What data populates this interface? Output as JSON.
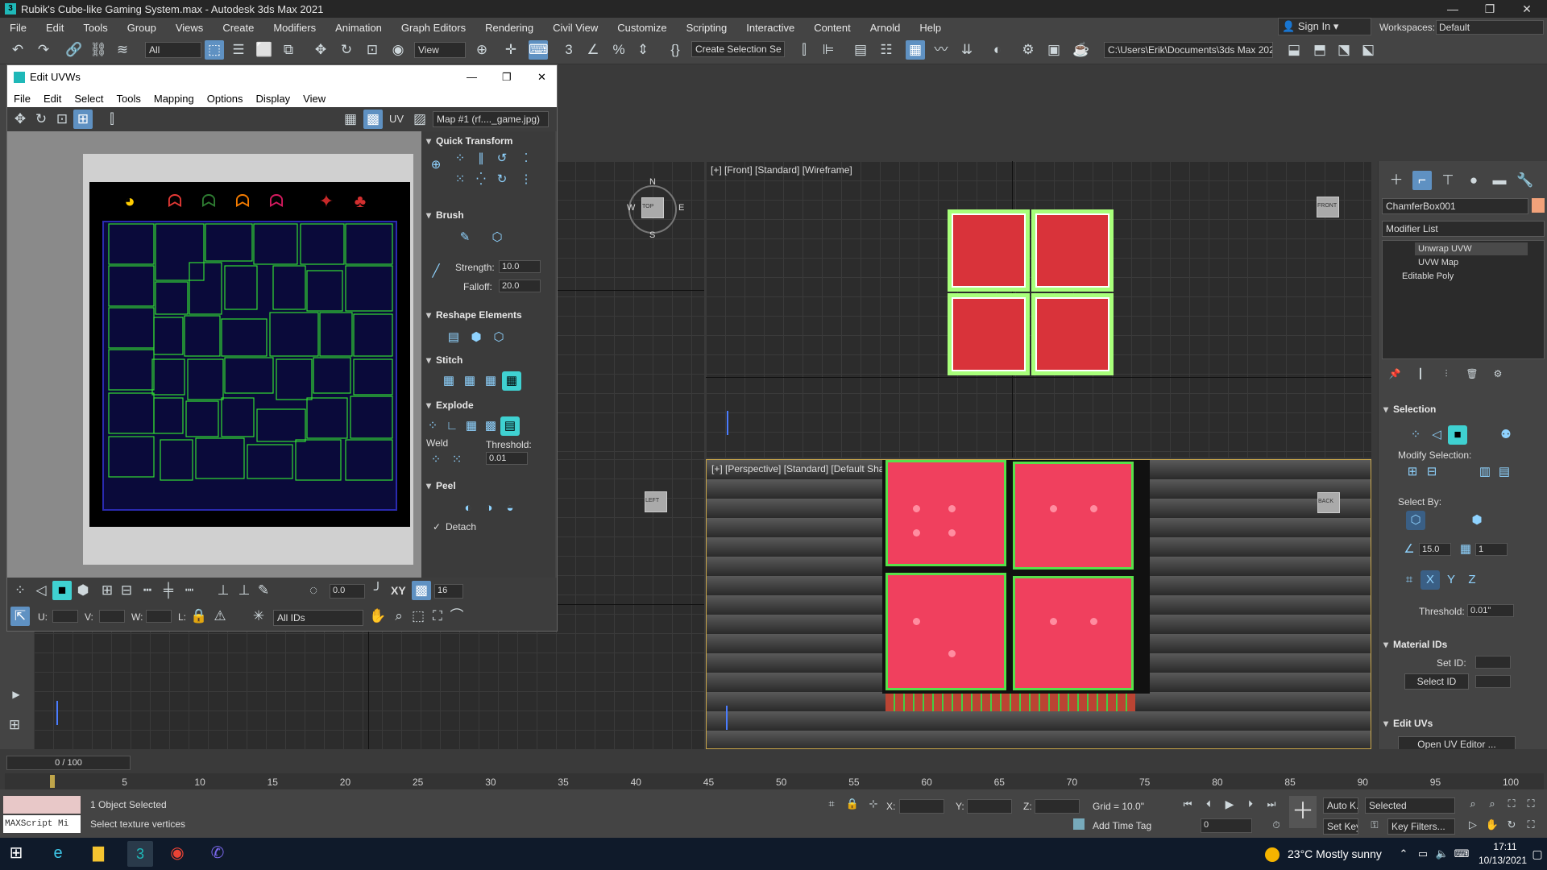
{
  "window": {
    "title": "Rubik's Cube-like Gaming System.max - Autodesk 3ds Max 2021",
    "min": "—",
    "max": "❐",
    "close": "✕"
  },
  "menu": [
    "File",
    "Edit",
    "Tools",
    "Group",
    "Views",
    "Create",
    "Modifiers",
    "Animation",
    "Graph Editors",
    "Rendering",
    "Civil View",
    "Customize",
    "Scripting",
    "Interactive",
    "Content",
    "Arnold",
    "Help"
  ],
  "account": {
    "sign_in": "Sign In",
    "workspaces_label": "Workspaces:",
    "workspace": "Default"
  },
  "toolbar": {
    "filter": "All",
    "ref_coord": "View",
    "selection_set": "Create Selection Se",
    "path": "C:\\Users\\Erik\\Documents\\3ds Max 2021"
  },
  "uv_editor": {
    "title": "Edit UVWs",
    "menu": [
      "File",
      "Edit",
      "Select",
      "Tools",
      "Mapping",
      "Options",
      "Display",
      "View"
    ],
    "uv_label": "UV",
    "map_dropdown": "Map #1 (rf...._game.jpg)",
    "sections": {
      "quick_transform": "Quick Transform",
      "brush": "Brush",
      "strength_label": "Strength:",
      "strength": "10.0",
      "falloff_label": "Falloff:",
      "falloff": "20.0",
      "reshape": "Reshape Elements",
      "stitch": "Stitch",
      "explode": "Explode",
      "weld_label": "Weld",
      "threshold_label": "Threshold:",
      "threshold": "0.01",
      "peel": "Peel",
      "detach": "Detach"
    },
    "bottom": {
      "rotation": "0.0",
      "xy": "XY",
      "grid_count": "16",
      "u_label": "U:",
      "v_label": "V:",
      "w_label": "W:",
      "l_label": "L:",
      "ids": "All IDs"
    }
  },
  "viewports": {
    "front": "[+] [Front] [Standard] [Wireframe]",
    "perspective": "[+] [Perspective] [Standard] [Default Shading]",
    "compass": {
      "n": "N",
      "s": "S",
      "e": "E",
      "w": "W",
      "top": "TOP"
    },
    "cube_labels": {
      "front": "FRONT",
      "left": "LEFT",
      "back": "BACK"
    }
  },
  "command_panel": {
    "object_name": "ChamferBox001",
    "object_color": "#f2a27a",
    "modifier_list": "Modifier List",
    "stack": [
      "Unwrap UVW",
      "UVW Map",
      "Editable Poly"
    ],
    "selection_title": "Selection",
    "modify_selection": "Modify Selection:",
    "select_by": "Select By:",
    "angle": "15.0",
    "count": "1",
    "threshold_label": "Threshold:",
    "threshold": "0.01\"",
    "material_ids": "Material IDs",
    "set_id": "Set ID:",
    "select_id": "Select ID",
    "edit_uvs": "Edit UVs",
    "open_uv_editor": "Open UV Editor ..."
  },
  "timeline": {
    "frame": "0 / 100",
    "ticks": [
      "5",
      "10",
      "15",
      "20",
      "25",
      "30",
      "35",
      "40",
      "45",
      "50",
      "55",
      "60",
      "65",
      "70",
      "75",
      "80",
      "85",
      "90",
      "95",
      "100"
    ]
  },
  "status": {
    "maxscript": "MAXScript Mi",
    "selected": "1 Object Selected",
    "prompt": "Select texture vertices",
    "x_label": "X:",
    "y_label": "Y:",
    "z_label": "Z:",
    "grid": "Grid = 10.0\"",
    "add_time_tag": "Add Time Tag",
    "auto_key": "Auto K...",
    "selected_dd": "Selected",
    "set_key": "Set Key",
    "key_filters": "Key Filters...",
    "frame_field": "0"
  },
  "taskbar": {
    "weather": "23°C  Mostly sunny",
    "time": "17:11",
    "date": "10/13/2021"
  },
  "colors": {
    "accent": "#5f91c2",
    "cube_red": "#d9333a",
    "uv_green": "#a8ff7a",
    "pink": "#f0405e"
  }
}
